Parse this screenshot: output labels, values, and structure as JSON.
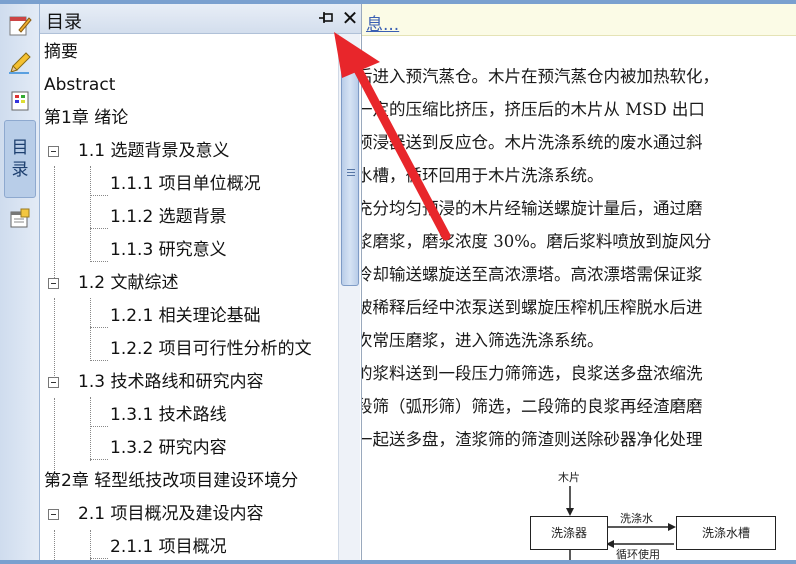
{
  "toc": {
    "title": "目录",
    "pin_icon": "pin-icon",
    "close_glyph": "✕",
    "items": [
      {
        "label": "摘要"
      },
      {
        "label": "Abstract"
      },
      {
        "label": "第1章 绪论"
      },
      {
        "label": "1.1 选题背景及意义"
      },
      {
        "label": "1.1.1 项目单位概况"
      },
      {
        "label": "1.1.2 选题背景"
      },
      {
        "label": "1.1.3 研究意义"
      },
      {
        "label": "1.2 文献综述"
      },
      {
        "label": "1.2.1 相关理论基础"
      },
      {
        "label": "1.2.2 项目可行性分析的文"
      },
      {
        "label": "1.3 技术路线和研究内容"
      },
      {
        "label": "1.3.1 技术路线"
      },
      {
        "label": "1.3.2 研究内容"
      },
      {
        "label": "第2章 轻型纸技改项目建设环境分"
      },
      {
        "label": "2.1 项目概况及建设内容"
      },
      {
        "label": "2.1.1 项目概况"
      }
    ]
  },
  "sidebar": {
    "tab_label_1": "目",
    "tab_label_2": "录"
  },
  "document": {
    "link_text": "息...",
    "lines": [
      "后进入预汽蒸仓。木片在预汽蒸仓内被加热软化，",
      "一定的压缩比挤压，挤压后的木片从 MSD 出口",
      "预浸器送到反应仓。木片洗涤系统的废水通过斜",
      "水槽，循环回用于木片洗涤系统。",
      "充分均匀预浸的木片经输送螺旋计量后，通过磨",
      "浆磨浆，磨浆浓度 30%。磨后浆料喷放到旋风分",
      "冷却输送螺旋送至高浓漂塔。高浓漂塔需保证浆",
      "被稀释后经中浓泵送到螺旋压榨机压榨脱水后进",
      "次常压磨浆，进入筛选洗涤系统。",
      "的浆料送到一段压力筛筛选，良浆送多盘浓缩洗",
      "段筛（弧形筛）筛选，二段筛的良浆再经渣磨磨",
      "一起送多盘，渣浆筛的筛渣则送除砂器净化处理"
    ],
    "diagram": {
      "top_label": "木片",
      "box_left": "洗涤器",
      "box_right": "洗涤水槽",
      "arrow_top_label": "洗涤水",
      "arrow_bottom_label": "循环使用"
    }
  },
  "annotation": {
    "arrow_color": "#e8262b"
  }
}
